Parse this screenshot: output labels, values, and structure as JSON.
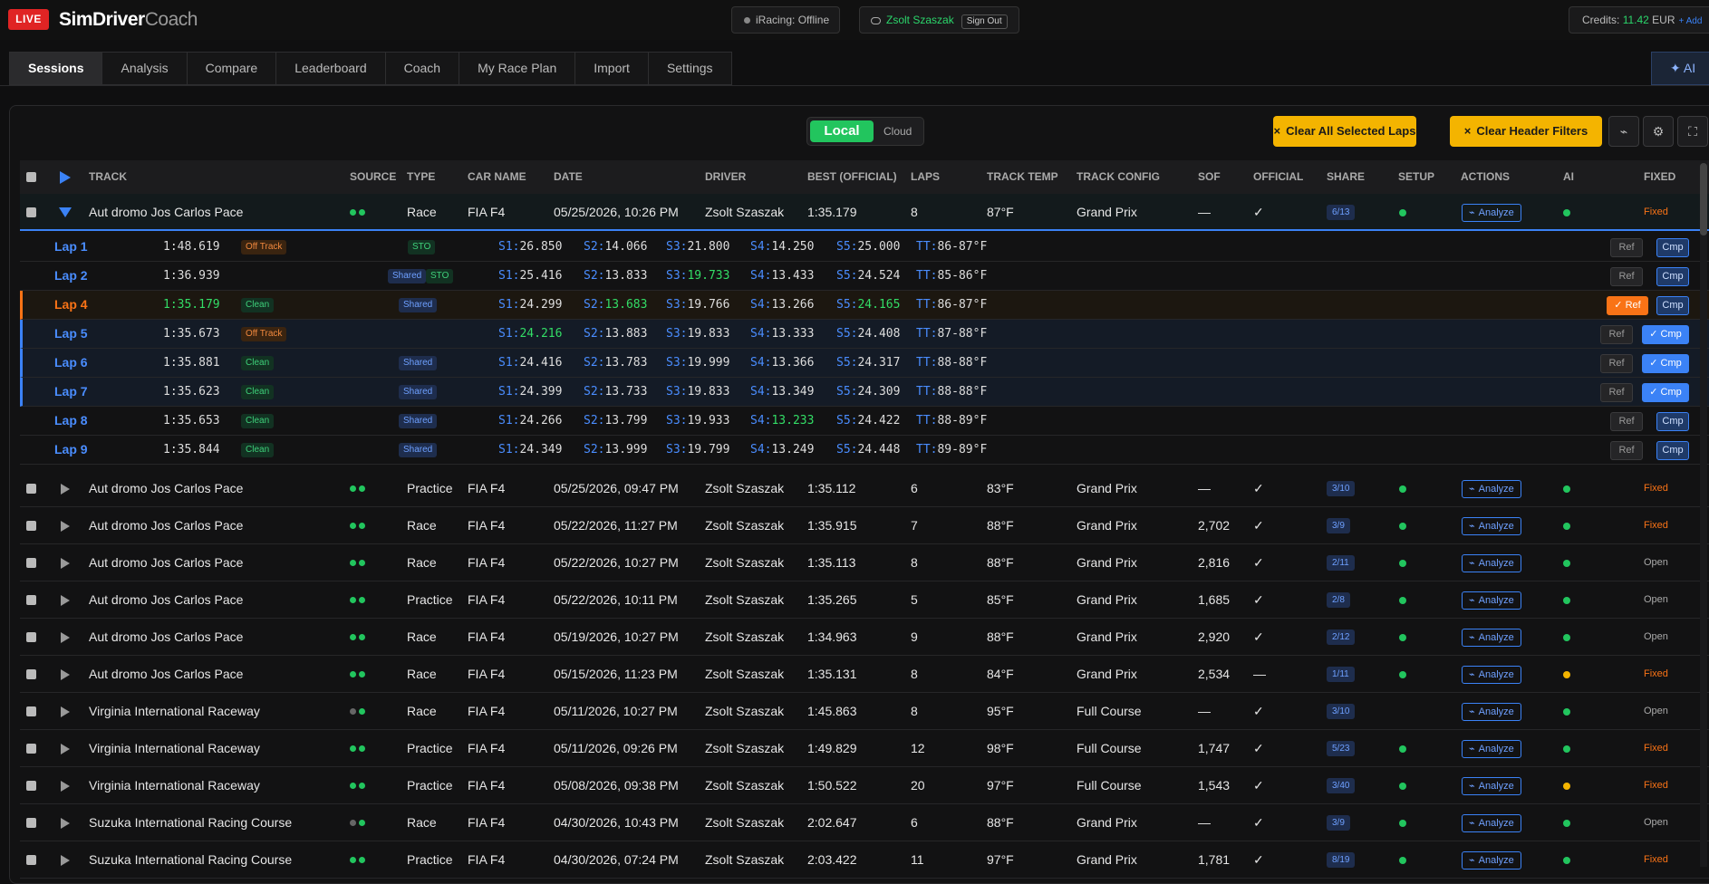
{
  "header": {
    "live_label": "LIVE",
    "brand_main": "SimDriver",
    "brand_sub": "Coach",
    "iracing_status": "iRacing: Offline",
    "user_name": "Zsolt Szaszak",
    "sign_out": "Sign Out",
    "credits_label": "Credits:",
    "credits_value": "11.42",
    "credits_currency": "EUR",
    "credits_add": "+ Add"
  },
  "tabs": [
    "Sessions",
    "Analysis",
    "Compare",
    "Leaderboard",
    "Coach",
    "My Race Plan",
    "Import",
    "Settings"
  ],
  "ai_button": "AI",
  "toolbar": {
    "local": "Local",
    "cloud": "Cloud",
    "clear_laps": "Clear All Selected Laps",
    "clear_filters": "Clear Header Filters"
  },
  "columns": [
    "TRACK",
    "SOURCE",
    "TYPE",
    "CAR NAME",
    "DATE",
    "DRIVER",
    "BEST (OFFICIAL)",
    "LAPS",
    "TRACK TEMP",
    "TRACK CONFIG",
    "SOF",
    "OFFICIAL",
    "SHARE",
    "SETUP",
    "ACTIONS",
    "AI",
    "FIXED"
  ],
  "colors": {
    "accent": "#3b82f6",
    "live": "#e02424",
    "green": "#22c55e",
    "yellow": "#f4b400",
    "orange": "#f97316"
  },
  "expanded_session": {
    "track": "Aut dromo Jos Carlos Pace",
    "type": "Race",
    "car": "FIA F4",
    "date": "05/25/2026, 10:26 PM",
    "driver": "Zsolt Szaszak",
    "best": "1:35.179",
    "laps": "8",
    "temp": "87°F",
    "config": "Grand Prix",
    "sof": "—",
    "official": "✓",
    "share": "6/13",
    "analyze": "Analyze",
    "fixed": "Fixed"
  },
  "laps": [
    {
      "name": "Lap 1",
      "time": "1:48.619",
      "tag": "Off Track",
      "tag_type": "off",
      "share": [
        "STO"
      ],
      "s1": "26.850",
      "s2": "14.066",
      "s3": "21.800",
      "s4": "14.250",
      "s5": "25.000",
      "tt": "86-87°F",
      "ref": "Ref",
      "cmp": "Cmp",
      "hl": "",
      "green": []
    },
    {
      "name": "Lap 2",
      "time": "1:36.939",
      "tag": "",
      "tag_type": "",
      "share": [
        "Shared",
        "STO"
      ],
      "s1": "25.416",
      "s2": "13.833",
      "s3": "19.733",
      "s4": "13.433",
      "s5": "24.524",
      "tt": "85-86°F",
      "ref": "Ref",
      "cmp": "Cmp",
      "hl": "",
      "green": [
        "s3"
      ]
    },
    {
      "name": "Lap 4",
      "time": "1:35.179",
      "tag": "Clean",
      "tag_type": "clean",
      "share": [
        "Shared"
      ],
      "s1": "24.299",
      "s2": "13.683",
      "s3": "19.766",
      "s4": "13.266",
      "s5": "24.165",
      "tt": "86-87°F",
      "ref": "✓ Ref",
      "cmp": "Cmp",
      "hl": "ref",
      "green": [
        "s2",
        "s5",
        "time"
      ]
    },
    {
      "name": "Lap 5",
      "time": "1:35.673",
      "tag": "Off Track",
      "tag_type": "off",
      "share": [],
      "s1": "24.216",
      "s2": "13.883",
      "s3": "19.833",
      "s4": "13.333",
      "s5": "24.408",
      "tt": "87-88°F",
      "ref": "Ref",
      "cmp": "✓ Cmp",
      "hl": "cmp",
      "green": [
        "s1"
      ]
    },
    {
      "name": "Lap 6",
      "time": "1:35.881",
      "tag": "Clean",
      "tag_type": "clean",
      "share": [
        "Shared"
      ],
      "s1": "24.416",
      "s2": "13.783",
      "s3": "19.999",
      "s4": "13.366",
      "s5": "24.317",
      "tt": "88-88°F",
      "ref": "Ref",
      "cmp": "✓ Cmp",
      "hl": "cmp",
      "green": []
    },
    {
      "name": "Lap 7",
      "time": "1:35.623",
      "tag": "Clean",
      "tag_type": "clean",
      "share": [
        "Shared"
      ],
      "s1": "24.399",
      "s2": "13.733",
      "s3": "19.833",
      "s4": "13.349",
      "s5": "24.309",
      "tt": "88-88°F",
      "ref": "Ref",
      "cmp": "✓ Cmp",
      "hl": "cmp",
      "green": []
    },
    {
      "name": "Lap 8",
      "time": "1:35.653",
      "tag": "Clean",
      "tag_type": "clean",
      "share": [
        "Shared"
      ],
      "s1": "24.266",
      "s2": "13.799",
      "s3": "19.933",
      "s4": "13.233",
      "s5": "24.422",
      "tt": "88-89°F",
      "ref": "Ref",
      "cmp": "Cmp",
      "hl": "",
      "green": [
        "s4"
      ]
    },
    {
      "name": "Lap 9",
      "time": "1:35.844",
      "tag": "Clean",
      "tag_type": "clean",
      "share": [
        "Shared"
      ],
      "s1": "24.349",
      "s2": "13.999",
      "s3": "19.799",
      "s4": "13.249",
      "s5": "24.448",
      "tt": "89-89°F",
      "ref": "Ref",
      "cmp": "Cmp",
      "hl": "",
      "green": []
    }
  ],
  "sessions": [
    {
      "track": "Aut dromo Jos Carlos Pace",
      "src": [
        "green",
        "green"
      ],
      "type": "Practice",
      "car": "FIA F4",
      "date": "05/25/2026, 09:47 PM",
      "driver": "Zsolt Szaszak",
      "best": "1:35.112",
      "laps": "6",
      "temp": "83°F",
      "config": "Grand Prix",
      "sof": "—",
      "official": "✓",
      "share": "3/10",
      "setup": "green",
      "analyze": "Analyze",
      "ai": "green",
      "fixed": "Fixed"
    },
    {
      "track": "Aut dromo Jos Carlos Pace",
      "src": [
        "green",
        "green"
      ],
      "type": "Race",
      "car": "FIA F4",
      "date": "05/22/2026, 11:27 PM",
      "driver": "Zsolt Szaszak",
      "best": "1:35.915",
      "laps": "7",
      "temp": "88°F",
      "config": "Grand Prix",
      "sof": "2,702",
      "official": "✓",
      "share": "3/9",
      "setup": "green",
      "analyze": "Analyze",
      "ai": "green",
      "fixed": "Fixed"
    },
    {
      "track": "Aut dromo Jos Carlos Pace",
      "src": [
        "green",
        "green"
      ],
      "type": "Race",
      "car": "FIA F4",
      "date": "05/22/2026, 10:27 PM",
      "driver": "Zsolt Szaszak",
      "best": "1:35.113",
      "laps": "8",
      "temp": "88°F",
      "config": "Grand Prix",
      "sof": "2,816",
      "official": "✓",
      "share": "2/11",
      "setup": "green",
      "analyze": "Analyze",
      "ai": "green",
      "fixed": "Open"
    },
    {
      "track": "Aut dromo Jos Carlos Pace",
      "src": [
        "green",
        "green"
      ],
      "type": "Practice",
      "car": "FIA F4",
      "date": "05/22/2026, 10:11 PM",
      "driver": "Zsolt Szaszak",
      "best": "1:35.265",
      "laps": "5",
      "temp": "85°F",
      "config": "Grand Prix",
      "sof": "1,685",
      "official": "✓",
      "share": "2/8",
      "setup": "green",
      "analyze": "Analyze",
      "ai": "green",
      "fixed": "Open"
    },
    {
      "track": "Aut dromo Jos Carlos Pace",
      "src": [
        "green",
        "green"
      ],
      "type": "Race",
      "car": "FIA F4",
      "date": "05/19/2026, 10:27 PM",
      "driver": "Zsolt Szaszak",
      "best": "1:34.963",
      "laps": "9",
      "temp": "88°F",
      "config": "Grand Prix",
      "sof": "2,920",
      "official": "✓",
      "share": "2/12",
      "setup": "green",
      "analyze": "Analyze",
      "ai": "green",
      "fixed": "Open"
    },
    {
      "track": "Aut dromo Jos Carlos Pace",
      "src": [
        "green",
        "green"
      ],
      "type": "Race",
      "car": "FIA F4",
      "date": "05/15/2026, 11:23 PM",
      "driver": "Zsolt Szaszak",
      "best": "1:35.131",
      "laps": "8",
      "temp": "84°F",
      "config": "Grand Prix",
      "sof": "2,534",
      "official": "—",
      "share": "1/11",
      "setup": "green",
      "analyze": "Analyze",
      "ai": "yellow",
      "fixed": "Fixed"
    },
    {
      "track": "Virginia International Raceway",
      "src": [
        "gray",
        "green"
      ],
      "type": "Race",
      "car": "FIA F4",
      "date": "05/11/2026, 10:27 PM",
      "driver": "Zsolt Szaszak",
      "best": "1:45.863",
      "laps": "8",
      "temp": "95°F",
      "config": "Full Course",
      "sof": "—",
      "official": "✓",
      "share": "3/10",
      "setup": "",
      "analyze": "Analyze",
      "ai": "green",
      "fixed": "Open"
    },
    {
      "track": "Virginia International Raceway",
      "src": [
        "green",
        "green"
      ],
      "type": "Practice",
      "car": "FIA F4",
      "date": "05/11/2026, 09:26 PM",
      "driver": "Zsolt Szaszak",
      "best": "1:49.829",
      "laps": "12",
      "temp": "98°F",
      "config": "Full Course",
      "sof": "1,747",
      "official": "✓",
      "share": "5/23",
      "setup": "green",
      "analyze": "Analyze",
      "ai": "green",
      "fixed": "Fixed"
    },
    {
      "track": "Virginia International Raceway",
      "src": [
        "green",
        "green"
      ],
      "type": "Practice",
      "car": "FIA F4",
      "date": "05/08/2026, 09:38 PM",
      "driver": "Zsolt Szaszak",
      "best": "1:50.522",
      "laps": "20",
      "temp": "97°F",
      "config": "Full Course",
      "sof": "1,543",
      "official": "✓",
      "share": "3/40",
      "setup": "green",
      "analyze": "Analyze",
      "ai": "yellow",
      "fixed": "Fixed"
    },
    {
      "track": "Suzuka International Racing Course",
      "src": [
        "gray",
        "green"
      ],
      "type": "Race",
      "car": "FIA F4",
      "date": "04/30/2026, 10:43 PM",
      "driver": "Zsolt Szaszak",
      "best": "2:02.647",
      "laps": "6",
      "temp": "88°F",
      "config": "Grand Prix",
      "sof": "—",
      "official": "✓",
      "share": "3/9",
      "setup": "green",
      "analyze": "Analyze",
      "ai": "green",
      "fixed": "Open"
    },
    {
      "track": "Suzuka International Racing Course",
      "src": [
        "green",
        "green"
      ],
      "type": "Practice",
      "car": "FIA F4",
      "date": "04/30/2026, 07:24 PM",
      "driver": "Zsolt Szaszak",
      "best": "2:03.422",
      "laps": "11",
      "temp": "97°F",
      "config": "Grand Prix",
      "sof": "1,781",
      "official": "✓",
      "share": "8/19",
      "setup": "green",
      "analyze": "Analyze",
      "ai": "green",
      "fixed": "Fixed"
    }
  ]
}
